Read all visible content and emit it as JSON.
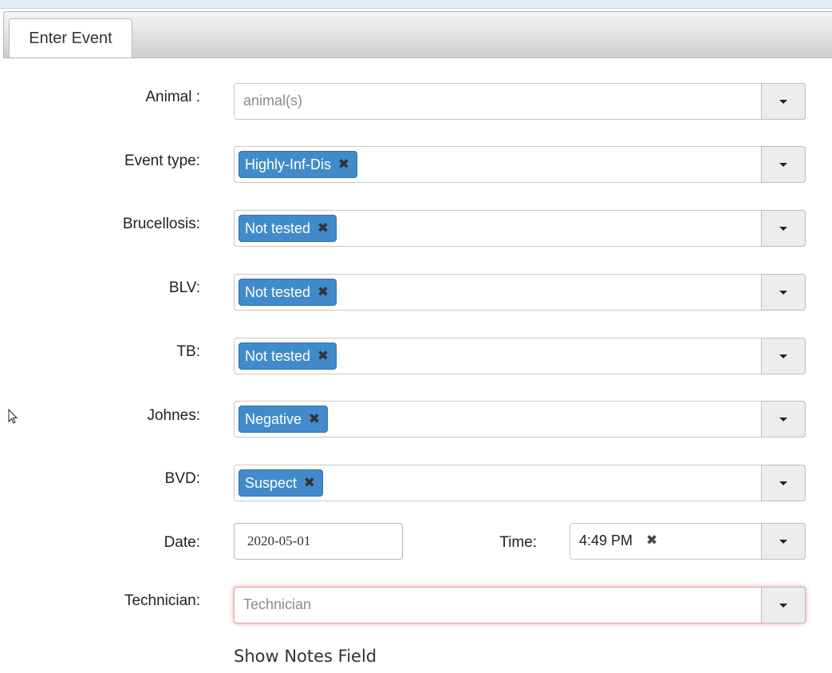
{
  "tab": {
    "label": "Enter Event"
  },
  "form": {
    "animal": {
      "label": "Animal :",
      "placeholder": "animal(s)"
    },
    "event_type": {
      "label": "Event type:",
      "selected": "Highly-Inf-Dis"
    },
    "brucellosis": {
      "label": "Brucellosis:",
      "selected": "Not tested"
    },
    "blv": {
      "label": "BLV:",
      "selected": "Not tested"
    },
    "tb": {
      "label": "TB:",
      "selected": "Not tested"
    },
    "johnes": {
      "label": "Johnes:",
      "selected": "Negative"
    },
    "bvd": {
      "label": "BVD:",
      "selected": "Suspect"
    },
    "date": {
      "label": "Date:",
      "value": "2020-05-01"
    },
    "time": {
      "label": "Time:",
      "value": "4:49 PM"
    },
    "technician": {
      "label": "Technician:",
      "placeholder": "Technician"
    },
    "show_notes": "Show Notes Field",
    "remove_glyph": "✖"
  },
  "colors": {
    "tag_bg": "#428bca",
    "invalid_glow": "#dc5050",
    "tab_gradient_end": "#cfcfcf"
  },
  "icons": {
    "dropdown": "caret-down-icon",
    "remove": "remove-x-icon",
    "cursor": "mouse-pointer-icon"
  }
}
